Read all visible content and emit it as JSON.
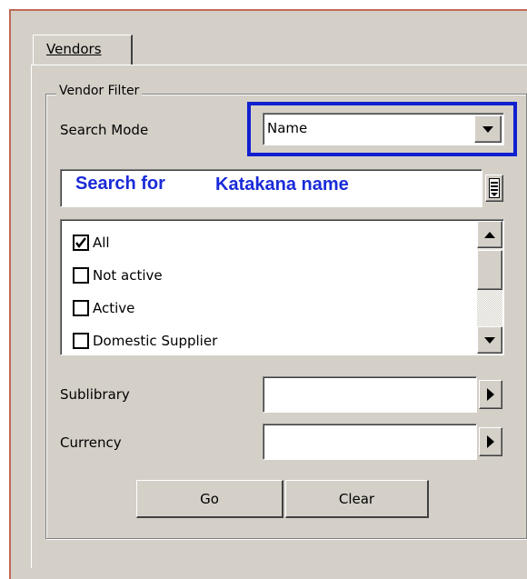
{
  "tabs": [
    {
      "label": "Vendors"
    }
  ],
  "vendor_filter": {
    "legend": "Vendor Filter",
    "search_mode": {
      "label": "Search Mode",
      "value": "Name"
    },
    "search": {
      "prefix": "Search for",
      "value": "Katakana name"
    },
    "status_list": [
      {
        "label": "All",
        "checked": true
      },
      {
        "label": "Not active",
        "checked": false
      },
      {
        "label": "Active",
        "checked": false
      },
      {
        "label": "Domestic Supplier",
        "checked": false
      }
    ],
    "sublibrary": {
      "label": "Sublibrary",
      "value": ""
    },
    "currency": {
      "label": "Currency",
      "value": ""
    }
  },
  "buttons": {
    "go": "Go",
    "clear": "Clear"
  },
  "colors": {
    "highlight": "#1020d0",
    "search_text": "#1a2bd8",
    "frame": "#bf6a55",
    "face": "#d4d0c8"
  }
}
